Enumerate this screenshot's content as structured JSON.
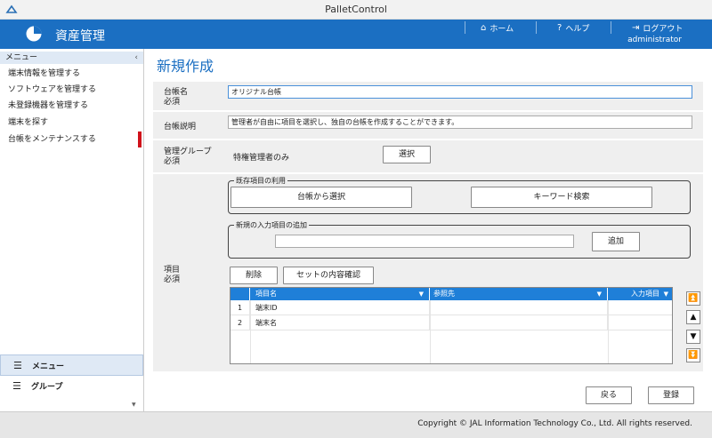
{
  "window": {
    "title": "PalletControl"
  },
  "header": {
    "app_name": "資産管理",
    "home": "ホーム",
    "help": "ヘルプ",
    "logout": "ログアウト",
    "user": "administrator",
    "color": "#1b6fc2"
  },
  "sidebar": {
    "menu_label": "メニュー",
    "collapse": "‹",
    "items": [
      {
        "label": "端末情報を管理する"
      },
      {
        "label": "ソフトウェアを管理する"
      },
      {
        "label": "未登録機器を管理する"
      },
      {
        "label": "端末を探す"
      },
      {
        "label": "台帳をメンテナンスする"
      }
    ],
    "bottom_tabs": [
      {
        "label": "メニュー"
      },
      {
        "label": "グループ"
      }
    ]
  },
  "page": {
    "title": "新規作成",
    "required": "必須",
    "ledger_name": {
      "label": "台帳名",
      "value": "オリジナル台帳"
    },
    "ledger_desc": {
      "label": "台帳説明",
      "value": "管理者が自由に項目を選択し、独自の台帳を作成することができます。"
    },
    "admin_group": {
      "label": "管理グループ",
      "value": "特権管理者のみ",
      "select_button": "選択"
    },
    "items": {
      "label": "項目",
      "existing": {
        "legend": "既存項目の利用",
        "from_ledger": "台帳から選択",
        "keyword": "キーワード検索"
      },
      "new": {
        "legend": "新規の入力項目の追加",
        "value": "",
        "add": "追加"
      },
      "delete": "削除",
      "confirm": "セットの内容確認",
      "grid": {
        "columns": [
          "項目名",
          "参照先",
          "入力項目"
        ],
        "rows": [
          {
            "no": "1",
            "name": "端末ID",
            "ref": "",
            "input": ""
          },
          {
            "no": "2",
            "name": "端末名",
            "ref": "",
            "input": ""
          }
        ]
      }
    },
    "back": "戻る",
    "register": "登録"
  },
  "footer": {
    "copyright": "Copyright © JAL Information Technology Co., Ltd. All rights reserved."
  }
}
